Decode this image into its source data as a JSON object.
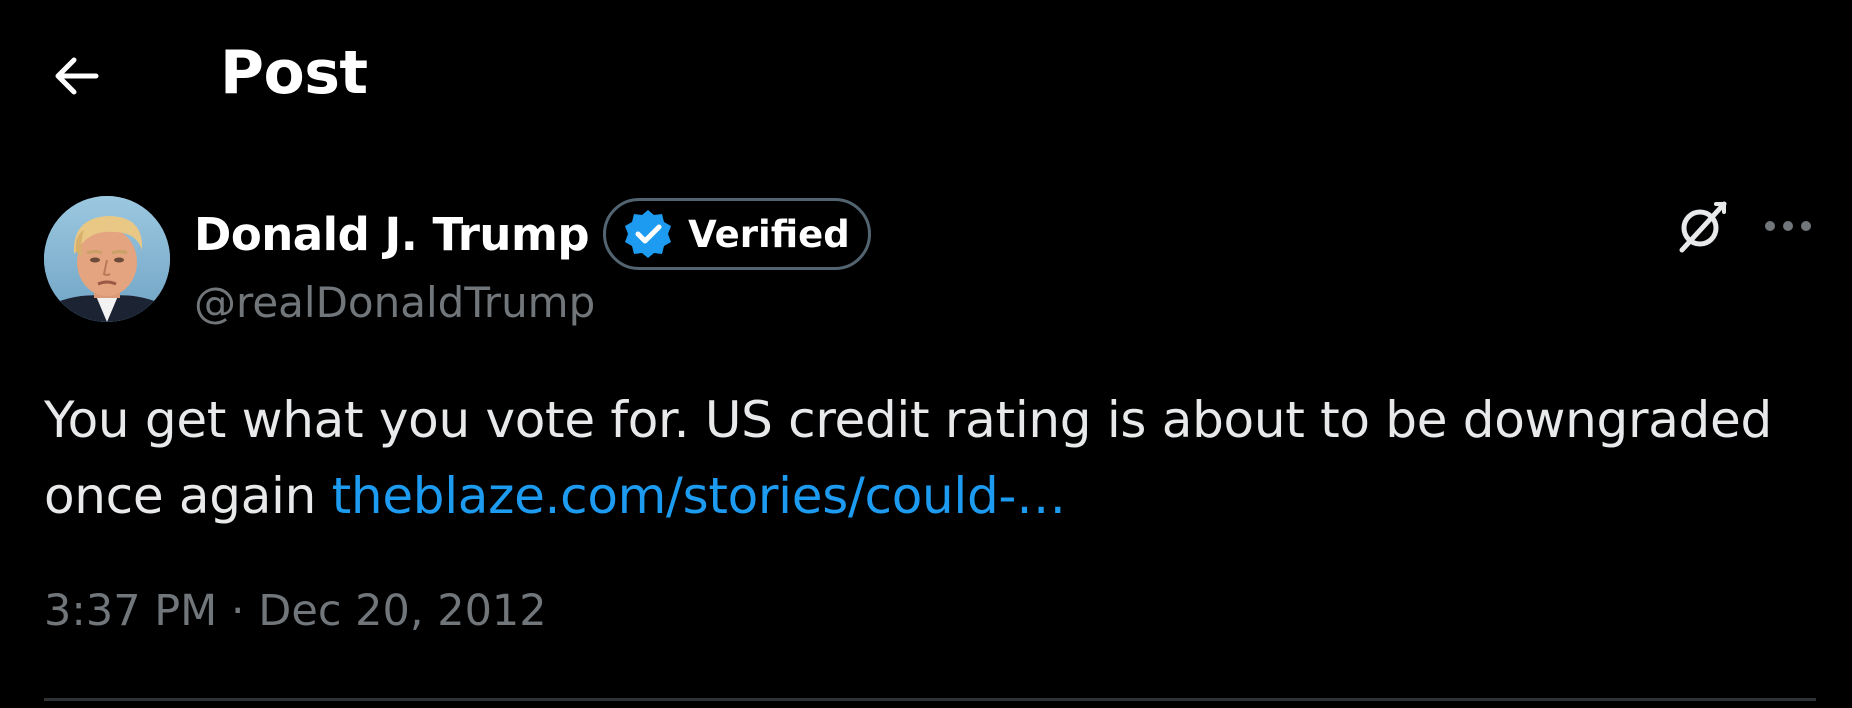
{
  "header": {
    "title": "Post",
    "back_icon": "arrow-left-icon"
  },
  "author": {
    "display_name": "Donald J. Trump",
    "handle": "@realDonaldTrump",
    "verified_label": "Verified",
    "verified_icon": "verified-badge-icon",
    "avatar_icon": "avatar-photo"
  },
  "actions": {
    "grok_icon": "grok-icon",
    "more_icon": "more-horizontal-icon"
  },
  "post": {
    "text": "You get what you vote for.  US credit rating is about to be downgraded once again ",
    "link_text": "theblaze.com/stories/could-…"
  },
  "meta": {
    "time": "3:37 PM",
    "separator": " · ",
    "date": "Dec 20, 2012"
  },
  "colors": {
    "background": "#000000",
    "primary_text": "#e7e9ea",
    "secondary_text": "#71767b",
    "link": "#1d9bf0",
    "verified_blue": "#1d9bf0",
    "border": "#536471",
    "divider": "#2f3336"
  }
}
